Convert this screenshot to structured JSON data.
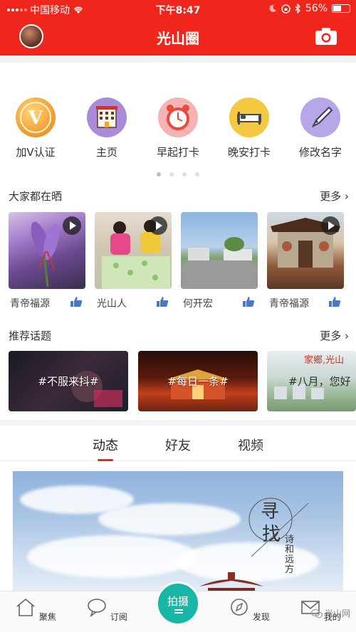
{
  "status_bar": {
    "carrier": "中国移动",
    "time": "下午8:47",
    "battery": "56%",
    "battery_level": 0.56
  },
  "header": {
    "title": "光山圈"
  },
  "quick_actions": [
    {
      "label": "加V认证",
      "icon": "v-badge-icon",
      "color": "#f3a53a"
    },
    {
      "label": "主页",
      "icon": "building-icon",
      "color": "#a98bd8"
    },
    {
      "label": "早起打卡",
      "icon": "alarm-clock-icon",
      "color": "#f5b3b3"
    },
    {
      "label": "晚安打卡",
      "icon": "bed-icon",
      "color": "#f5c842"
    },
    {
      "label": "修改名字",
      "icon": "pen-icon",
      "color": "#b7a6e8"
    }
  ],
  "pager": {
    "total": 4,
    "current": 0
  },
  "showcase": {
    "title": "大家都在晒",
    "more": "更多",
    "items": [
      {
        "author": "青帝福源",
        "has_video": true
      },
      {
        "author": "光山人",
        "has_video": true
      },
      {
        "author": "何开宏",
        "has_video": false
      },
      {
        "author": "青帝福源",
        "has_video": true
      }
    ]
  },
  "topics": {
    "title": "推荐话题",
    "more": "更多",
    "items": [
      {
        "tag": "#不服来抖#"
      },
      {
        "tag": "#每日一条#"
      },
      {
        "tag": "#八月，您好"
      }
    ]
  },
  "tabs": [
    {
      "label": "动态",
      "active": true
    },
    {
      "label": "好友",
      "active": false
    },
    {
      "label": "视频",
      "active": false
    }
  ],
  "feed_image": {
    "poem_line1": "寻",
    "poem_line2": "找",
    "poem_side": "诗和远方"
  },
  "bottom_nav": [
    {
      "label": "聚焦",
      "icon": "home-icon"
    },
    {
      "label": "订阅",
      "icon": "chat-bubble-icon"
    },
    {
      "label": "拍摄",
      "icon": "shoot-icon"
    },
    {
      "label": "发现",
      "icon": "compass-icon"
    },
    {
      "label": "我的",
      "icon": "mail-icon"
    }
  ],
  "watermark": "光山网"
}
